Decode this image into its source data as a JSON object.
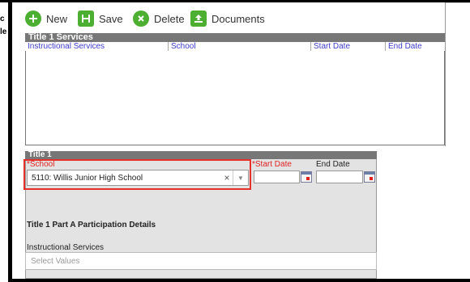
{
  "background_window": {
    "fragment_1": "c",
    "fragment_2": "le"
  },
  "toolbar": {
    "new_label": "New",
    "save_label": "Save",
    "delete_label": "Delete",
    "documents_label": "Documents",
    "colors": {
      "new": "#4caf32",
      "save": "#4caf32",
      "delete": "#4caf32",
      "documents": "#4caf32"
    }
  },
  "services_table": {
    "title": "Title 1 Services",
    "columns": [
      {
        "label": "Instructional Services"
      },
      {
        "label": "School"
      },
      {
        "label": "Start Date"
      },
      {
        "label": "End Date"
      }
    ],
    "rows": []
  },
  "title1_form": {
    "title": "Title 1",
    "school_label": "*School",
    "school_value": "5110: Willis Junior High School",
    "start_date_label": "*Start Date",
    "end_date_label": "End Date",
    "start_date_value": "",
    "end_date_value": "",
    "details_title": "Title 1 Part A Participation Details",
    "instructional_services_label": "Instructional Services",
    "instructional_services_placeholder": "Select Values"
  },
  "colors": {
    "section_header": "#777777",
    "required_label": "#e0201e",
    "column_header_text": "#3c3cc8",
    "highlight_box": "#e8302a"
  }
}
